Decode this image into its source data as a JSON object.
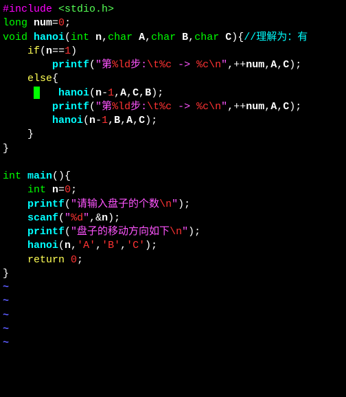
{
  "l1": {
    "preproc": "#include",
    "header": "<stdio.h>"
  },
  "l2": {
    "t": "long ",
    "id": "num",
    "eq": "=",
    "n": "0",
    "sc": ";"
  },
  "l3": {
    "t": "void ",
    "fn": "hanoi",
    "p1": "(",
    "t2": "int ",
    "a1": "n",
    "c1": ",",
    "t3": "char ",
    "a2": "A",
    "c2": ",",
    "t4": "char ",
    "a3": "B",
    "c3": ",",
    "t5": "char ",
    "a4": "C",
    "p2": ")",
    "br": "{",
    "cm": "//理解为：有"
  },
  "l4": {
    "ind": "    ",
    "kw": "if",
    "p1": "(",
    "id": "n",
    "eq": "==",
    "n": "1",
    "p2": ")"
  },
  "l5": {
    "ind": "        ",
    "fn": "printf",
    "p1": "(",
    "s1": "\"第",
    "f1": "%ld",
    "s2": "步:",
    "e1": "\\t",
    "f2": "%c",
    "s3": " -> ",
    "f3": "%c",
    "e2": "\\n",
    "s4": "\"",
    "c1": ",++",
    "id": "num",
    "c2": ",",
    "a1": "A",
    "c3": ",",
    "a2": "C",
    "p2": ")",
    ";": ";"
  },
  "l6": {
    "ind": "    ",
    "kw": "else",
    "br": "{"
  },
  "l7": {
    "ind": "     ",
    "sp": "   ",
    "fn": "hanoi",
    "p1": "(",
    "id": "n",
    "op": "-",
    "n": "1",
    "c1": ",",
    "a1": "A",
    "c2": ",",
    "a2": "C",
    "c3": ",",
    "a3": "B",
    "p2": ")",
    ";": ";"
  },
  "l8": {
    "ind": "        ",
    "fn": "printf",
    "p1": "(",
    "s1": "\"第",
    "f1": "%ld",
    "s2": "步:",
    "e1": "\\t",
    "f2": "%c",
    "s3": " -> ",
    "f3": "%c",
    "e2": "\\n",
    "s4": "\"",
    "c1": ",++",
    "id": "num",
    "c2": ",",
    "a1": "A",
    "c3": ",",
    "a2": "C",
    "p2": ")",
    ";": ";"
  },
  "l9": {
    "ind": "        ",
    "fn": "hanoi",
    "p1": "(",
    "id": "n",
    "op": "-",
    "n": "1",
    "c1": ",",
    "a1": "B",
    "c2": ",",
    "a2": "A",
    "c3": ",",
    "a3": "C",
    "p2": ")",
    ";": ";"
  },
  "l10": {
    "ind": "    ",
    "br": "}"
  },
  "l11": {
    "br": "}"
  },
  "l12": {
    "blank": " "
  },
  "l13": {
    "t": "int ",
    "fn": "main",
    "p": "()",
    "br": "{"
  },
  "l14": {
    "ind": "    ",
    "t": "int ",
    "id": "n",
    "eq": "=",
    "n": "0",
    ";": ";"
  },
  "l15": {
    "ind": "    ",
    "fn": "printf",
    "p1": "(",
    "s1": "\"请输入盘子的个数",
    "e": "\\n",
    "s2": "\"",
    "p2": ")",
    ";": ";"
  },
  "l16": {
    "ind": "    ",
    "fn": "scanf",
    "p1": "(",
    "s1": "\"",
    "f": "%d",
    "s2": "\"",
    "c": ",&",
    "id": "n",
    "p2": ")",
    ";": ";"
  },
  "l17": {
    "ind": "    ",
    "fn": "printf",
    "p1": "(",
    "s1": "\"盘子的移动方向如下",
    "e": "\\n",
    "s2": "\"",
    "p2": ")",
    ";": ";"
  },
  "l18": {
    "ind": "    ",
    "fn": "hanoi",
    "p1": "(",
    "id": "n",
    "c1": ",",
    "ch1": "'A'",
    "c2": ",",
    "ch2": "'B'",
    "c3": ",",
    "ch3": "'C'",
    "p2": ")",
    ";": ";"
  },
  "l19": {
    "ind": "    ",
    "kw": "return ",
    "n": "0",
    ";": ";"
  },
  "l20": {
    "br": "}"
  },
  "tilde": "~"
}
